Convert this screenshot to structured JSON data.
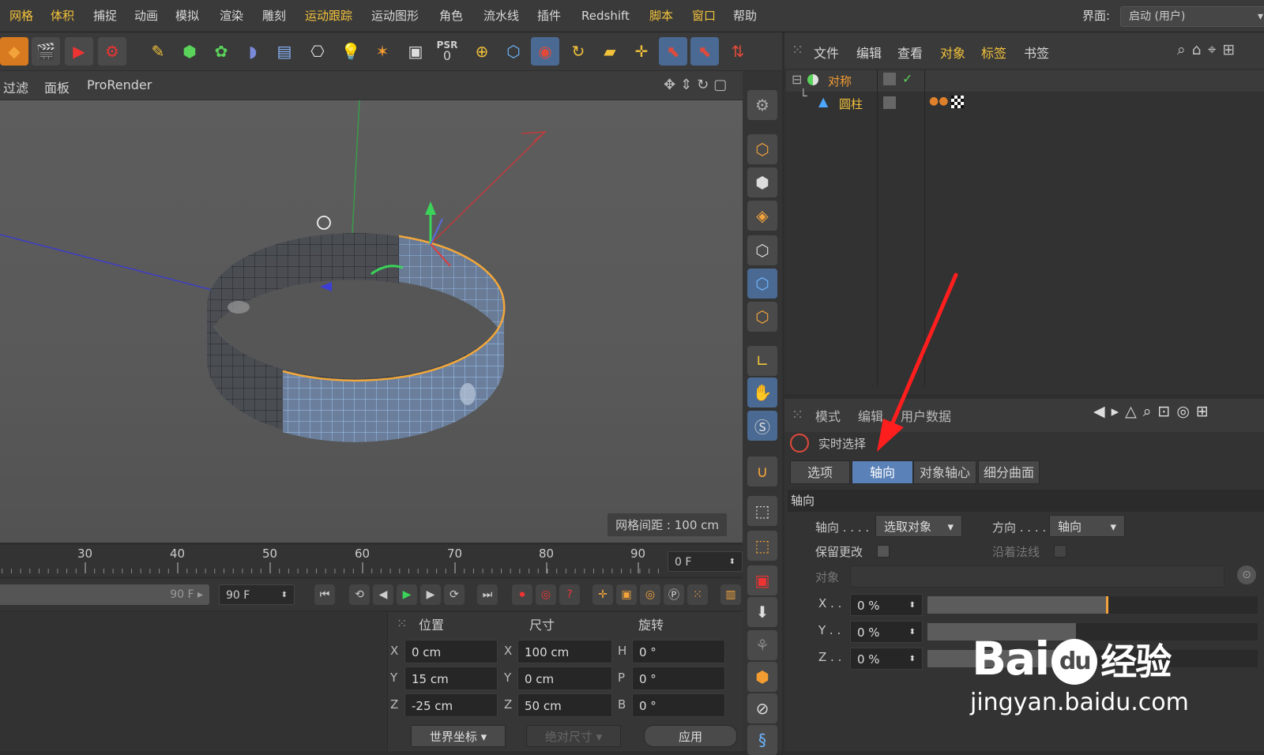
{
  "menu": {
    "items": [
      {
        "label": "网格",
        "hl": true
      },
      {
        "label": "体积",
        "hl": true
      },
      {
        "label": "捕捉"
      },
      {
        "label": "动画"
      },
      {
        "label": "模拟"
      },
      {
        "label": "渲染"
      },
      {
        "label": "雕刻"
      },
      {
        "label": "运动跟踪",
        "hl": true
      },
      {
        "label": "运动图形"
      },
      {
        "label": "角色"
      },
      {
        "label": "流水线"
      },
      {
        "label": "插件"
      },
      {
        "label": "Redshift"
      },
      {
        "label": "脚本",
        "hl": true
      },
      {
        "label": "窗口",
        "hl": true
      },
      {
        "label": "帮助"
      }
    ],
    "interface_label": "界面:",
    "interface_value": "启动 (用户)"
  },
  "toolbar": {
    "psr_label": "PSR",
    "psr_value": "0",
    "icons": [
      "cube-icon",
      "film-clapper-icon",
      "render-view-icon",
      "render-settings-icon",
      "pen-icon",
      "cube-green-icon",
      "flower-icon",
      "deformer-icon",
      "floor-icon",
      "camera-icon",
      "light-bulb-icon",
      "symmetry-icon",
      "snapshot-icon",
      "psr-icon",
      "xyz-icon",
      "view-cube-icon",
      "live-selection-icon",
      "rotate-icon",
      "scale-icon",
      "move-icon",
      "selection-icon",
      "selection2-icon",
      "coordinate-icon"
    ]
  },
  "viewport": {
    "menu": [
      "过滤",
      "面板",
      "ProRender"
    ],
    "grid_label": "网格间距 : 100 cm"
  },
  "timeline": {
    "ticks": [
      "30",
      "40",
      "50",
      "60",
      "70",
      "80",
      "90"
    ],
    "current_frame": "0 F",
    "end_frame_slider": "90 F",
    "end_frame": "90 F"
  },
  "coords": {
    "headers": {
      "position": "位置",
      "size": "尺寸",
      "rotation": "旋转"
    },
    "rows": [
      {
        "axis": "X",
        "pos": "0 cm",
        "size_axis": "X",
        "size": "100 cm",
        "rot_axis": "H",
        "rot": "0 °"
      },
      {
        "axis": "Y",
        "pos": "15 cm",
        "size_axis": "Y",
        "size": "0 cm",
        "rot_axis": "P",
        "rot": "0 °"
      },
      {
        "axis": "Z",
        "pos": "-25 cm",
        "size_axis": "Z",
        "size": "50 cm",
        "rot_axis": "B",
        "rot": "0 °"
      }
    ],
    "world_btn": "世界坐标",
    "abs_btn": "绝对尺寸",
    "apply_btn": "应用"
  },
  "objects": {
    "menu": [
      "文件",
      "编辑",
      "查看",
      "对象",
      "标签",
      "书签"
    ],
    "items": [
      {
        "name": "对称",
        "color": "#f39c32"
      },
      {
        "name": "圆柱",
        "color": "#f3c23b"
      }
    ]
  },
  "attributes": {
    "menu": [
      "模式",
      "编辑",
      "用户数据"
    ],
    "tool_name": "实时选择",
    "tabs": [
      "选项",
      "轴向",
      "对象轴心",
      "细分曲面"
    ],
    "active_tab": "轴向",
    "section": "轴向",
    "axis_label": "轴向 . . . .",
    "axis_value": "选取对象",
    "dir_label": "方向 . . . .",
    "dir_value": "轴向",
    "keep_label": "保留更改",
    "normal_label": "沿着法线",
    "object_label": "对象",
    "xyz": [
      {
        "label": "X . .",
        "value": "0 %",
        "fill": 0.54
      },
      {
        "label": "Y . .",
        "value": "0 %",
        "fill": 0.45
      },
      {
        "label": "Z . .",
        "value": "0 %",
        "fill": 0.45
      }
    ]
  },
  "watermark": {
    "brand": "Bai",
    "brand2": "du",
    "suffix": "经验",
    "url": "jingyan.baidu.com"
  }
}
